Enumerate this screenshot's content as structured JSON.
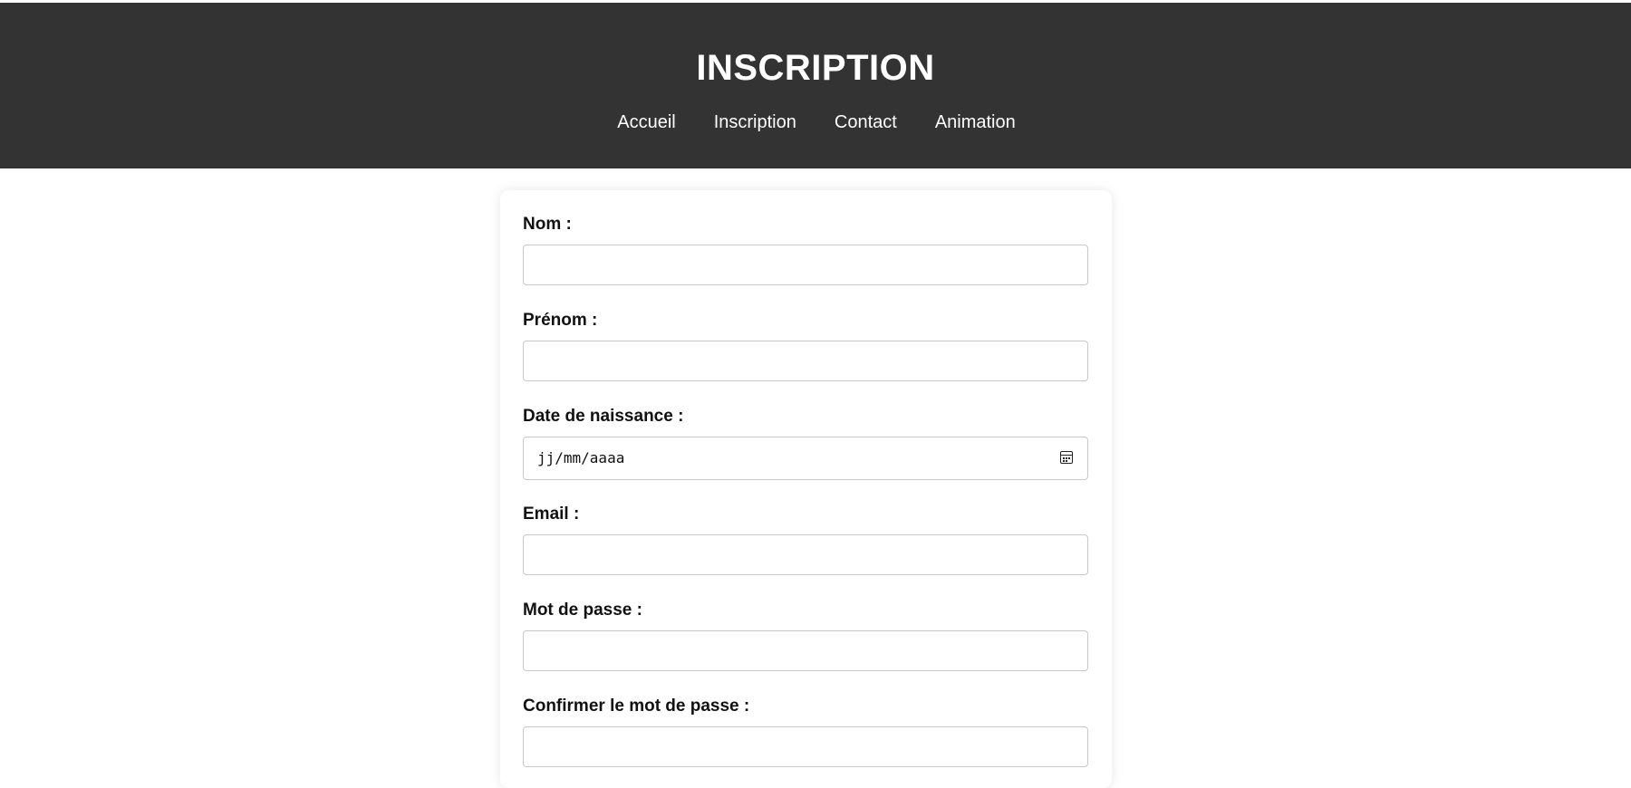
{
  "header": {
    "title": "INSCRIPTION",
    "nav": [
      "Accueil",
      "Inscription",
      "Contact",
      "Animation"
    ]
  },
  "form": {
    "fields": [
      {
        "label": "Nom :",
        "value": ""
      },
      {
        "label": "Prénom :",
        "value": ""
      },
      {
        "label": "Date de naissance :",
        "value": "jj/mm/aaaa",
        "icon": "calendar-icon"
      },
      {
        "label": "Email :",
        "value": ""
      },
      {
        "label": "Mot de passe :",
        "value": ""
      },
      {
        "label": "Confirmer le mot de passe :",
        "value": ""
      }
    ]
  },
  "colors": {
    "header_bg": "#333333",
    "header_text": "#ffffff",
    "card_bg": "#ffffff",
    "input_border": "#c8c8c8"
  }
}
